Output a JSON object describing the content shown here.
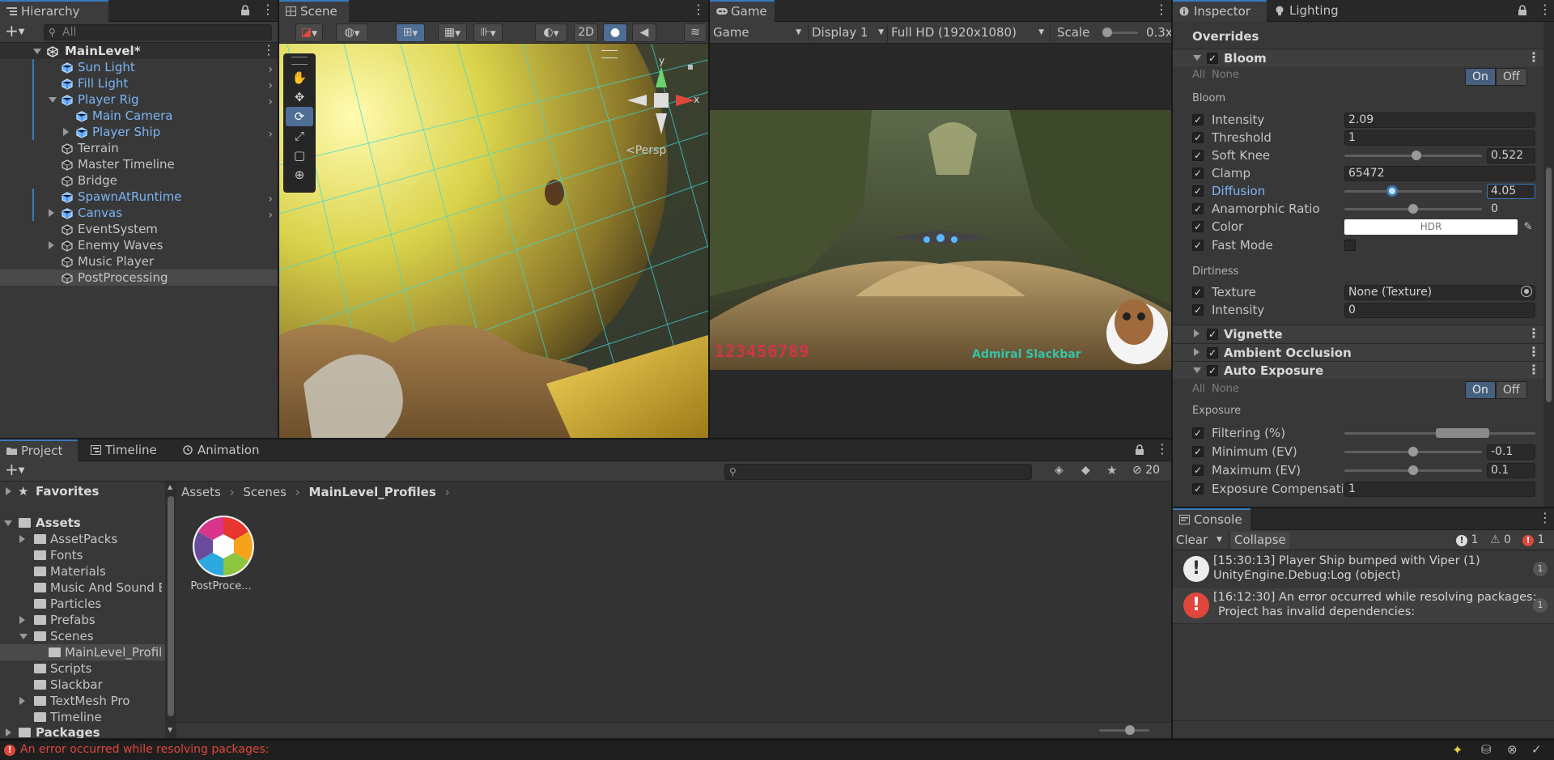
{
  "hierarchy": {
    "tab_label": "Hierarchy",
    "search_placeholder": "All",
    "scene_name": "MainLevel*",
    "items": [
      {
        "label": "Sun Light",
        "depth": 1,
        "prefab": true,
        "expandable": false,
        "has_arrow": true
      },
      {
        "label": "Fill Light",
        "depth": 1,
        "prefab": true,
        "expandable": false,
        "has_arrow": true
      },
      {
        "label": "Player Rig",
        "depth": 1,
        "prefab": true,
        "expandable": true,
        "expanded": true,
        "has_arrow": true
      },
      {
        "label": "Main Camera",
        "depth": 2,
        "prefab": true,
        "expandable": false,
        "has_arrow": false
      },
      {
        "label": "Player Ship",
        "depth": 2,
        "prefab": true,
        "expandable": true,
        "expanded": false,
        "has_arrow": true
      },
      {
        "label": "Terrain",
        "depth": 1,
        "prefab": false,
        "expandable": false,
        "has_arrow": false
      },
      {
        "label": "Master Timeline",
        "depth": 1,
        "prefab": false,
        "expandable": false,
        "has_arrow": false
      },
      {
        "label": "Bridge",
        "depth": 1,
        "prefab": false,
        "expandable": false,
        "has_arrow": false
      },
      {
        "label": "SpawnAtRuntime",
        "depth": 1,
        "prefab": true,
        "expandable": false,
        "has_arrow": true
      },
      {
        "label": "Canvas",
        "depth": 1,
        "prefab": true,
        "expandable": true,
        "expanded": false,
        "has_arrow": true
      },
      {
        "label": "EventSystem",
        "depth": 1,
        "prefab": false,
        "expandable": false,
        "has_arrow": false
      },
      {
        "label": "Enemy Waves",
        "depth": 1,
        "prefab": false,
        "expandable": true,
        "expanded": false,
        "has_arrow": false
      },
      {
        "label": "Music Player",
        "depth": 1,
        "prefab": false,
        "expandable": false,
        "has_arrow": false
      },
      {
        "label": "PostProcessing",
        "depth": 1,
        "prefab": false,
        "expandable": false,
        "has_arrow": false,
        "selected": true
      }
    ]
  },
  "scene": {
    "tab_label": "Scene",
    "btn_2d": "2D",
    "persp_label": "<Persp",
    "gizmo_y": "y",
    "gizmo_x": "x"
  },
  "game": {
    "tab_label": "Game",
    "mode": "Game",
    "display": "Display 1",
    "resolution": "Full HD (1920x1080)",
    "scale_label": "Scale",
    "scale_value": "0.3x",
    "hud_score": "123456789",
    "hud_name": "Admiral Slackbar"
  },
  "inspector": {
    "tab_label": "Inspector",
    "lighting_tab_label": "Lighting",
    "overrides_label": "Overrides",
    "all_label": "All",
    "none_label": "None",
    "on_label": "On",
    "off_label": "Off",
    "bloom": {
      "title": "Bloom",
      "group_label": "Bloom",
      "intensity_label": "Intensity",
      "intensity": "2.09",
      "threshold_label": "Threshold",
      "threshold": "1",
      "soft_knee_label": "Soft Knee",
      "soft_knee": "0.522",
      "soft_knee_fraction": 0.522,
      "clamp_label": "Clamp",
      "clamp": "65472",
      "diffusion_label": "Diffusion",
      "diffusion": "4.05",
      "diffusion_fraction": 0.34,
      "anamorphic_label": "Anamorphic Ratio",
      "anamorphic": "0",
      "anamorphic_fraction": 0.5,
      "color_label": "Color",
      "color_value": "HDR",
      "fast_mode_label": "Fast Mode",
      "dirtiness_label": "Dirtiness",
      "texture_label": "Texture",
      "texture": "None (Texture)",
      "dirt_intensity_label": "Intensity",
      "dirt_intensity": "0"
    },
    "vignette_title": "Vignette",
    "ao_title": "Ambient Occlusion",
    "auto_exposure": {
      "title": "Auto Exposure",
      "group_label": "Exposure",
      "filtering_label": "Filtering (%)",
      "minimum_label": "Minimum (EV)",
      "minimum": "-0.1",
      "minimum_fraction": 0.5,
      "maximum_label": "Maximum (EV)",
      "maximum": "0.1",
      "maximum_fraction": 0.5,
      "compensation_label": "Exposure Compensatio",
      "compensation": "1"
    }
  },
  "project": {
    "tab_label": "Project",
    "timeline_tab_label": "Timeline",
    "animation_tab_label": "Animation",
    "hidden_count": "20",
    "favorites_label": "Favorites",
    "assets_label": "Assets",
    "packages_label": "Packages",
    "folders": [
      {
        "label": "AssetPacks",
        "depth": 1,
        "expandable": true
      },
      {
        "label": "Fonts",
        "depth": 1,
        "expandable": false
      },
      {
        "label": "Materials",
        "depth": 1,
        "expandable": false
      },
      {
        "label": "Music And Sound Ef",
        "depth": 1,
        "expandable": false
      },
      {
        "label": "Particles",
        "depth": 1,
        "expandable": false
      },
      {
        "label": "Prefabs",
        "depth": 1,
        "expandable": true
      },
      {
        "label": "Scenes",
        "depth": 1,
        "expandable": true,
        "expanded": true
      },
      {
        "label": "MainLevel_Profile",
        "depth": 2,
        "expandable": false,
        "selected": true
      },
      {
        "label": "Scripts",
        "depth": 1,
        "expandable": false
      },
      {
        "label": "Slackbar",
        "depth": 1,
        "expandable": false
      },
      {
        "label": "TextMesh Pro",
        "depth": 1,
        "expandable": true
      },
      {
        "label": "Timeline",
        "depth": 1,
        "expandable": false
      }
    ],
    "breadcrumb": [
      "Assets",
      "Scenes",
      "MainLevel_Profiles"
    ],
    "asset_label": "PostProce..."
  },
  "console": {
    "tab_label": "Console",
    "clear_label": "Clear",
    "collapse_label": "Collapse",
    "log_count": "1",
    "warn_count": "0",
    "error_count": "1",
    "entries": [
      {
        "type": "log",
        "line1": "[15:30:13] Player Ship bumped with Viper (1)",
        "line2": "UnityEngine.Debug:Log (object)",
        "count": "1"
      },
      {
        "type": "error",
        "line1": "[16:12:30] An error occurred while resolving packages:",
        "line2": "Project has invalid dependencies:",
        "count": "1"
      }
    ]
  },
  "status_bar": {
    "message": "An error occurred while resolving packages:"
  },
  "colors": {
    "accent": "#3a79bb",
    "prefab_blue": "#7cb4f4",
    "error_red": "#e0473c"
  }
}
